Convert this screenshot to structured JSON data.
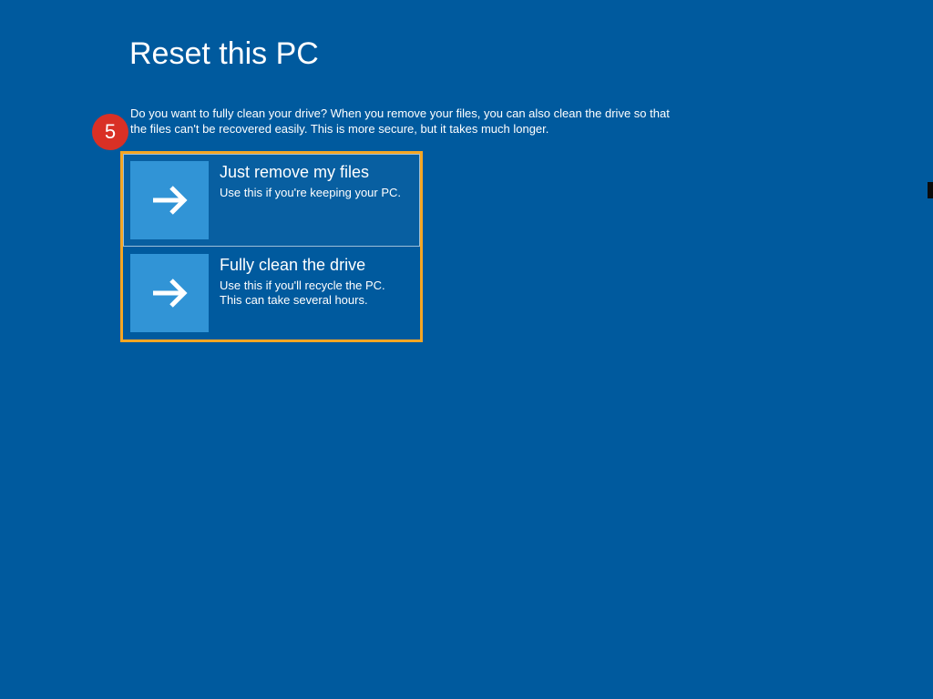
{
  "title": "Reset this PC",
  "description": "Do you want to fully clean your drive? When you remove your files, you can also clean the drive so that the files can't be recovered easily. This is more secure, but it takes much longer.",
  "badge": "5",
  "options": [
    {
      "title": "Just remove my files",
      "desc": "Use this if you're keeping your PC."
    },
    {
      "title": "Fully clean the drive",
      "desc": "Use this if you'll recycle the PC. This can take several hours."
    }
  ],
  "colors": {
    "background": "#005a9e",
    "highlight_border": "#f5a623",
    "badge": "#d93025",
    "tile": "#3194d6"
  }
}
